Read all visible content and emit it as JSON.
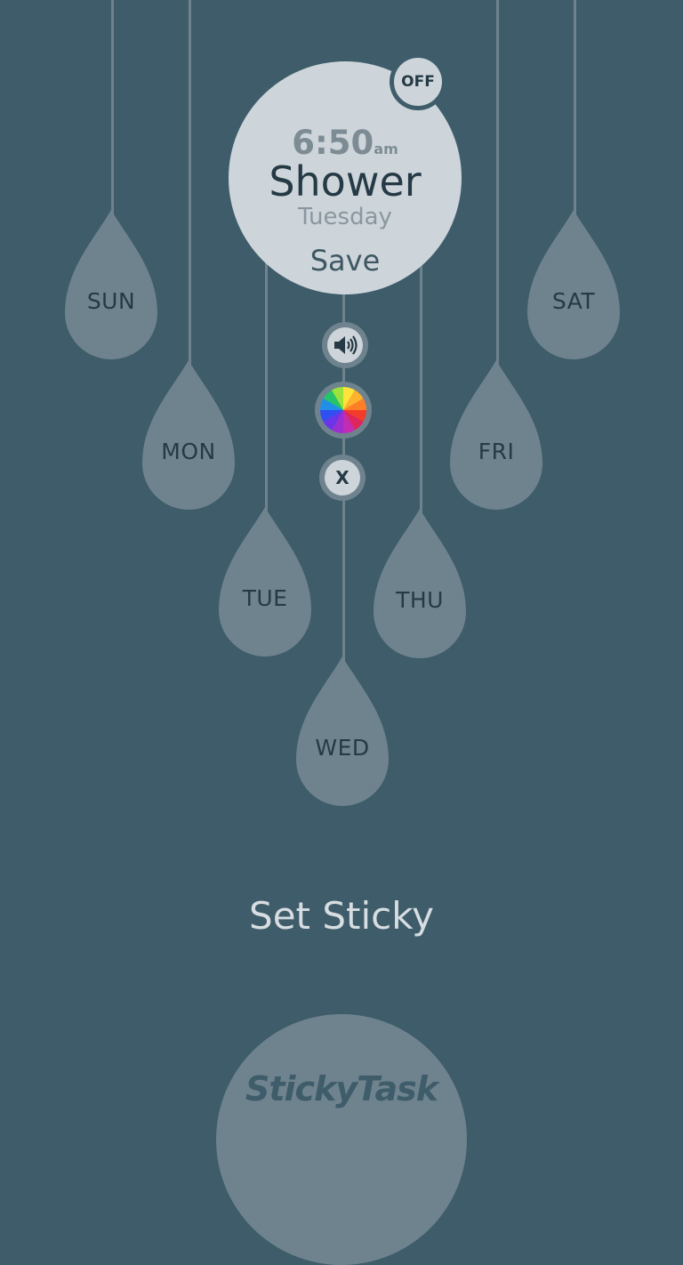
{
  "task": {
    "time": "6:50",
    "ampm": "am",
    "title": "Shower",
    "day": "Tuesday",
    "save_label": "Save",
    "toggle_label": "OFF"
  },
  "controls": {
    "close_label": "X",
    "sound_icon": "speaker-icon",
    "color_icon": "color-wheel-icon"
  },
  "days": [
    {
      "label": "SUN"
    },
    {
      "label": "MON"
    },
    {
      "label": "TUE"
    },
    {
      "label": "WED"
    },
    {
      "label": "THU"
    },
    {
      "label": "FRI"
    },
    {
      "label": "SAT"
    }
  ],
  "action_label": "Set Sticky",
  "brand": "StickyTask",
  "colors": {
    "background": "#3e5c6a",
    "drop": "#6e838d",
    "card": "#cdd5da",
    "text_dark": "#253a45"
  }
}
